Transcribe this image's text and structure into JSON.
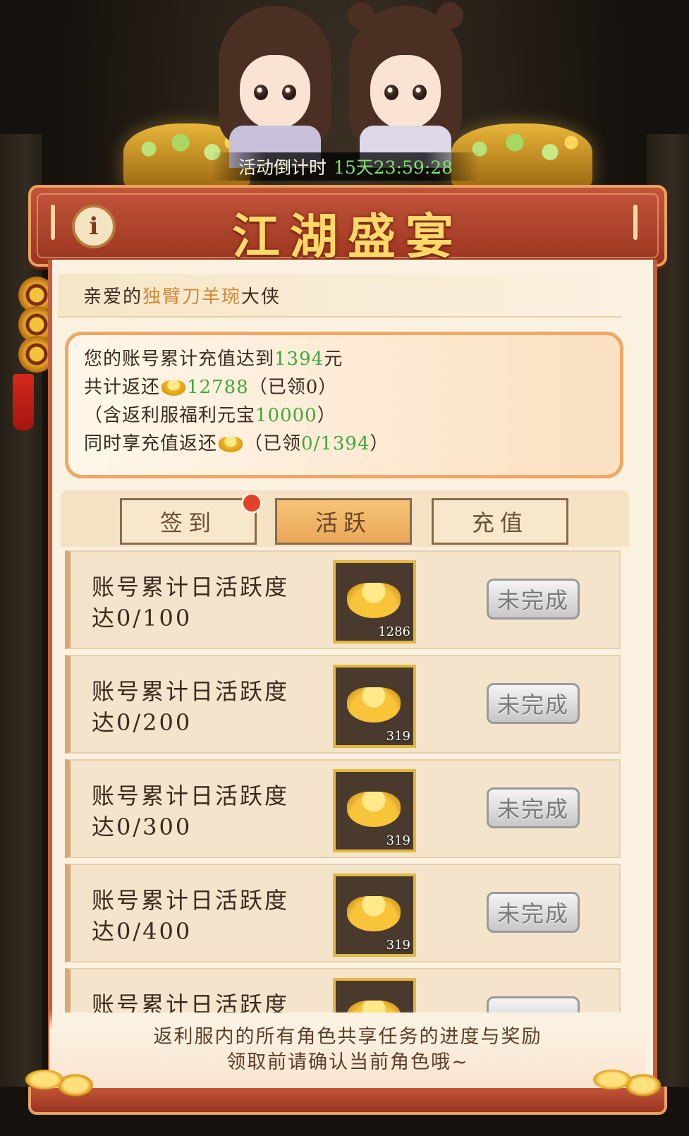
{
  "countdown": {
    "label": "活动倒计时",
    "time": "15天23:59:28"
  },
  "title": "江湖盛宴",
  "info_icon": "i",
  "greeting": {
    "prefix": "亲爱的",
    "name": "独臂刀羊琬",
    "suffix": "大侠"
  },
  "summary": {
    "line1_prefix": "您的账号累计充值达到",
    "line1_amount": "1394",
    "line1_suffix": "元",
    "line2_prefix": "共计返还",
    "line2_amount": "12788",
    "line2_suffix": "（已领0）",
    "line3_prefix": "（含返利服福利元宝",
    "line3_amount": "10000",
    "line3_suffix": "）",
    "line4_prefix": "同时享充值返还",
    "line4_mid": "（已领",
    "line4_amount": "0/1394",
    "line4_suffix": "）"
  },
  "tabs": [
    {
      "label": "签到",
      "active": false,
      "badge": true
    },
    {
      "label": "活跃",
      "active": true,
      "badge": false
    },
    {
      "label": "充值",
      "active": false,
      "badge": false
    }
  ],
  "tasks": [
    {
      "line1": "账号累计日活跃度",
      "line2": "达0/100",
      "reward_qty": "1286",
      "status": "未完成"
    },
    {
      "line1": "账号累计日活跃度",
      "line2": "达0/200",
      "reward_qty": "319",
      "status": "未完成"
    },
    {
      "line1": "账号累计日活跃度",
      "line2": "达0/300",
      "reward_qty": "319",
      "status": "未完成"
    },
    {
      "line1": "账号累计日活跃度",
      "line2": "达0/400",
      "reward_qty": "319",
      "status": "未完成"
    },
    {
      "line1": "账号累计日活跃度",
      "line2": "",
      "reward_qty": "",
      "status": ""
    }
  ],
  "footer": {
    "line1": "返利服内的所有角色共享任务的进度与奖励",
    "line2": "领取前请确认当前角色哦~"
  },
  "colors": {
    "accent_green": "#3fa83a",
    "title_gold": "#ffd86a",
    "frame_red": "#b2442a"
  },
  "icons": [
    "info-icon",
    "gold-ingot-icon",
    "copper-coin-icon"
  ]
}
